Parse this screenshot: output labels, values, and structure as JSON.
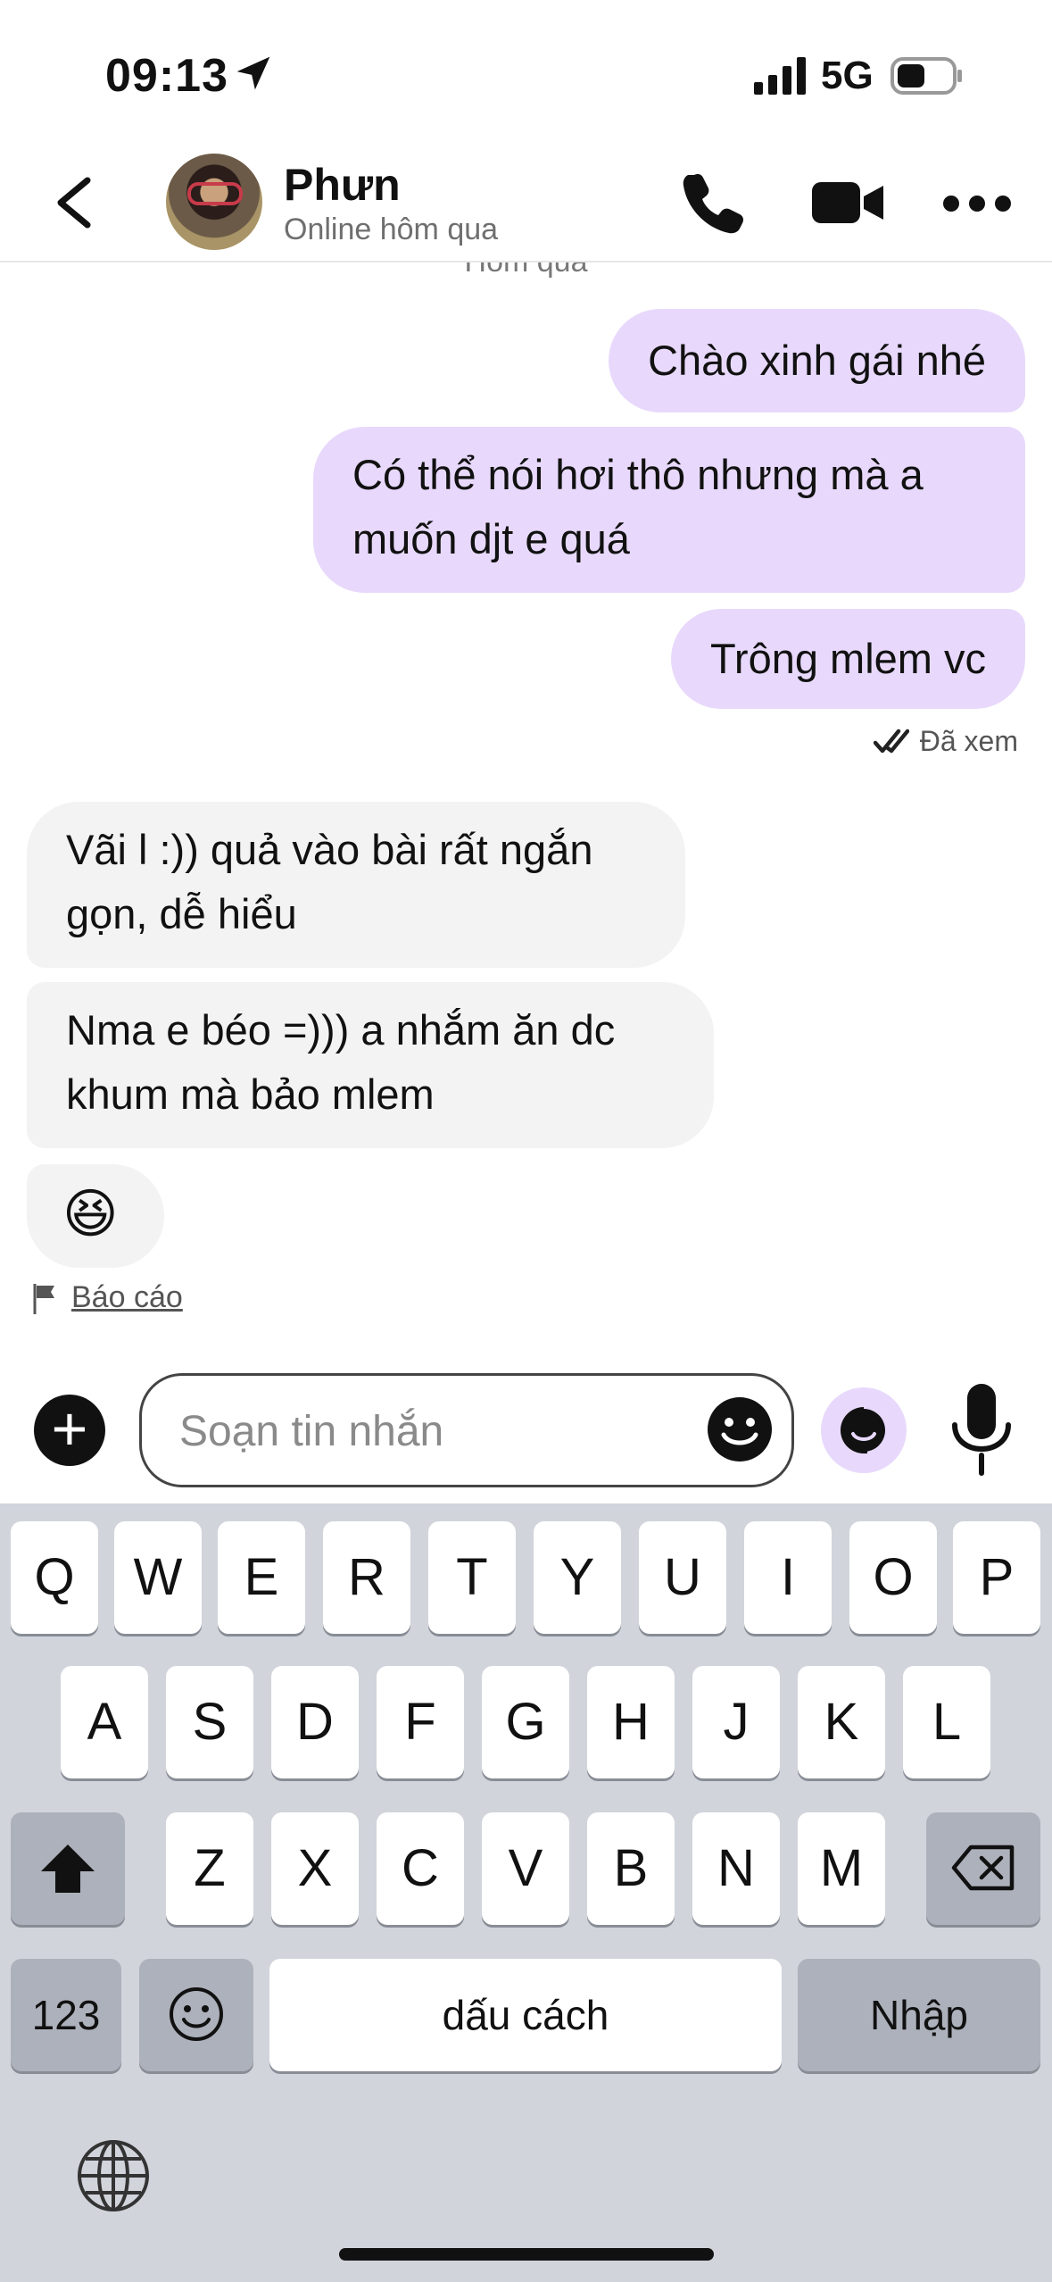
{
  "status_bar": {
    "time": "09:13",
    "network": "5G"
  },
  "header": {
    "name": "Phưn",
    "presence": "Online hôm qua"
  },
  "chat": {
    "day_label": "Hôm qua",
    "messages": [
      {
        "dir": "out",
        "text": "Chào xinh gái nhé"
      },
      {
        "dir": "out",
        "text": "Có thể nói hơi thô nhưng mà a muốn djt e quá"
      },
      {
        "dir": "out",
        "text": "Trông mlem vc"
      },
      {
        "dir": "in",
        "text": "Vãi l :)) quả vào bài rất ngắn gọn, dễ hiểu"
      },
      {
        "dir": "in",
        "text": "Nma e béo =))) a nhắm ăn dc khum mà bảo mlem"
      },
      {
        "dir": "in",
        "text": "😆"
      }
    ],
    "seen_label": "Đã xem",
    "report_label": "Báo cáo"
  },
  "composer": {
    "placeholder": "Soạn tin nhắn",
    "value": ""
  },
  "keyboard": {
    "row1": [
      "Q",
      "W",
      "E",
      "R",
      "T",
      "Y",
      "U",
      "I",
      "O",
      "P"
    ],
    "row2": [
      "A",
      "S",
      "D",
      "F",
      "G",
      "H",
      "J",
      "K",
      "L"
    ],
    "row3": [
      "Z",
      "X",
      "C",
      "V",
      "B",
      "N",
      "M"
    ],
    "numbers_label": "123",
    "space_label": "dấu cách",
    "return_label": "Nhập"
  },
  "colors": {
    "outgoing_bubble": "#e8d9fc",
    "incoming_bubble": "#f3f3f3",
    "keyboard_bg": "#d1d4db"
  }
}
